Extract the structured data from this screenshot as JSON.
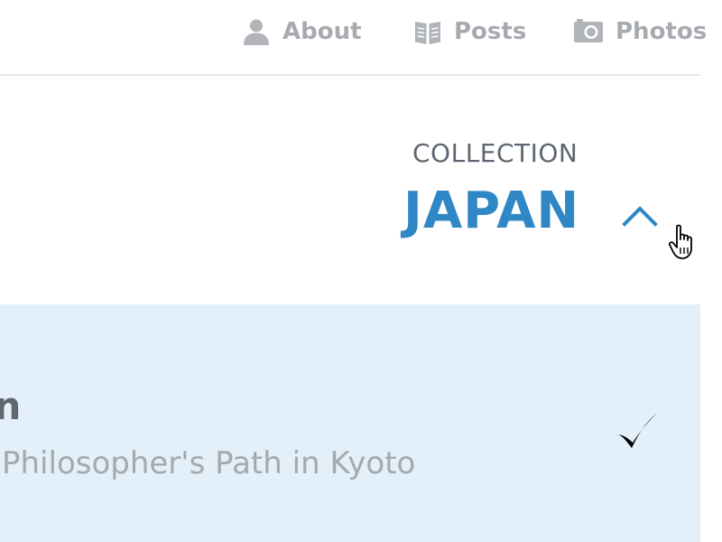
{
  "nav": {
    "items": [
      {
        "label": "About",
        "icon": "person-icon"
      },
      {
        "label": "Posts",
        "icon": "book-icon"
      },
      {
        "label": "Photos",
        "icon": "camera-icon"
      }
    ]
  },
  "collection": {
    "label": "COLLECTION",
    "title": "JAPAN",
    "toggle_icon": "chevron-up-icon"
  },
  "selected_item": {
    "title": "en",
    "subtitle": "Philosopher's Path in Kyoto",
    "status_icon": "checkmark-icon"
  },
  "colors": {
    "accent": "#2f87c6",
    "nav_text": "#a7abb0",
    "panel_bg": "#e3f0f9",
    "label_text": "#5e6671"
  }
}
